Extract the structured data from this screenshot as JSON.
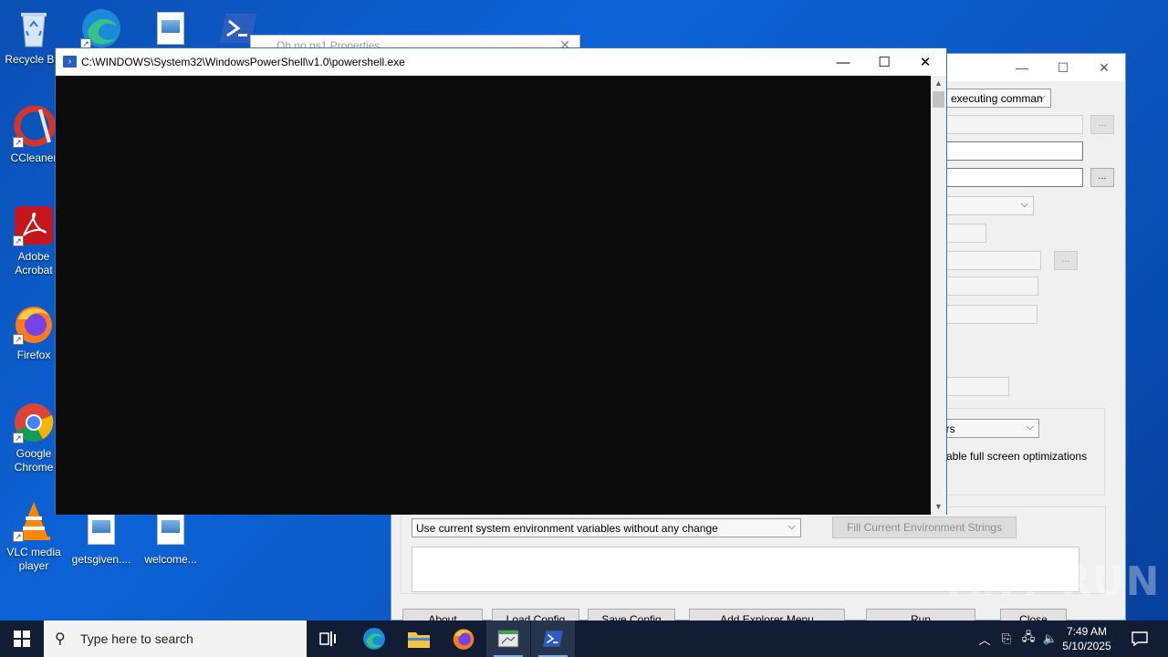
{
  "desktop": {
    "icons": [
      {
        "label": "Recycle Bin"
      },
      {
        "label": "CCleaner"
      },
      {
        "label": "Adobe Acrobat"
      },
      {
        "label": "Firefox"
      },
      {
        "label": "Google Chrome"
      },
      {
        "label": "VLC media player"
      },
      {
        "label": "getsgiven...."
      },
      {
        "label": "welcome..."
      }
    ]
  },
  "background_dialog": {
    "title": "Oh no.ps1 Properties"
  },
  "app_window": {
    "dropdown_exec": "executing comman",
    "dropdown_color": "ors",
    "checkbox_text": "able full screen optimizations",
    "env_dropdown": "Use current system environment variables without any change",
    "fill_env_button": "Fill Current Environment Strings",
    "ellipsis": "...",
    "buttons": {
      "about": "About",
      "load_config": "Load Config",
      "save_config": "Save Config",
      "add_explorer_menu": "Add Explorer Menu",
      "run": "Run",
      "close": "Close"
    }
  },
  "powershell": {
    "title": "C:\\WINDOWS\\System32\\WindowsPowerShell\\v1.0\\powershell.exe"
  },
  "watermark": "ANY RUN",
  "taskbar": {
    "search_placeholder": "Type here to search",
    "time": "7:49 AM",
    "date": "5/10/2025"
  },
  "colors": {
    "desktop_bg": "#0c63d6",
    "taskbar_bg": "#101d33",
    "console_bg": "#0c0c0c",
    "accent": "#78aef0"
  }
}
